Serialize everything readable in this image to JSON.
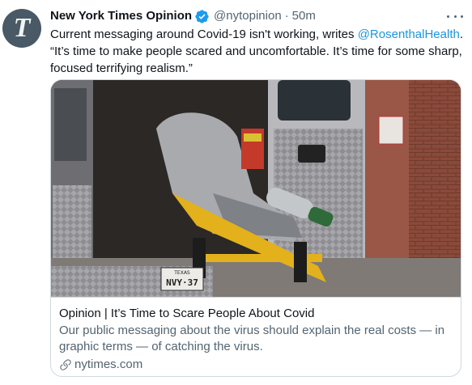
{
  "author": {
    "display_name": "New York Times Opinion",
    "handle": "@nytopinion",
    "avatar_letter": "T",
    "verified": true
  },
  "meta": {
    "separator": "·",
    "timestamp": "50m"
  },
  "tweet": {
    "text_before_mention": "Current messaging around Covid-19 isn't working, writes ",
    "mention": "@RosenthalHealth",
    "text_after_mention": ".",
    "quote": "“It’s time to make people scared and uncomfortable. It’s time for some sharp, focused terrifying realism.”"
  },
  "card": {
    "image_alt": "Ambulance stretcher with oxygen tank",
    "plate_text": "TEXAS",
    "plate_number": "NVY·37",
    "title": "Opinion | It’s Time to Scare People About Covid",
    "description": "Our public messaging about the virus should explain the real costs — in graphic terms — of catching the virus.",
    "domain": "nytimes.com"
  },
  "colors": {
    "link": "#1b95e0",
    "verified": "#1d9bf0",
    "secondary_text": "#536471",
    "border": "#cfd9de"
  },
  "icons": {
    "verified": "verified-badge-icon",
    "more": "more-horizontal-icon",
    "link": "link-icon"
  }
}
